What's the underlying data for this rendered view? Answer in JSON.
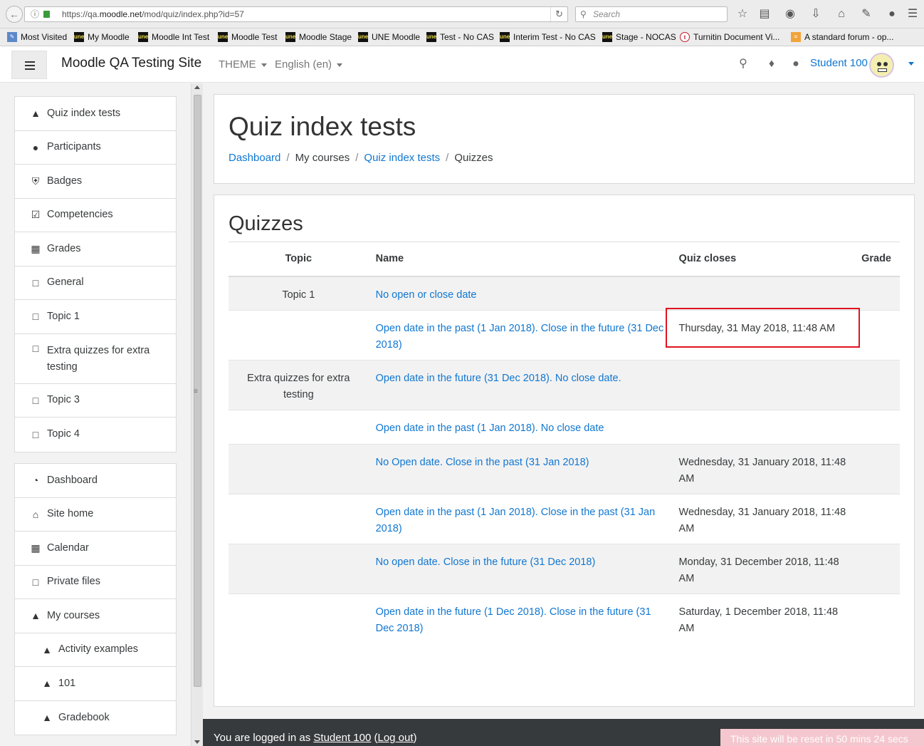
{
  "browser": {
    "url_prefix": "https://qa.",
    "url_host": "moodle.net",
    "url_path": "/mod/quiz/index.php?id=57",
    "search_placeholder": "Search",
    "bookmarks": [
      {
        "label": "Most Visited",
        "icon": "most-visited-icon"
      },
      {
        "label": "My Moodle",
        "icon": "une-icon"
      },
      {
        "label": "Moodle Int Test",
        "icon": "une-icon"
      },
      {
        "label": "Moodle Test",
        "icon": "une-icon"
      },
      {
        "label": "Moodle Stage",
        "icon": "une-icon"
      },
      {
        "label": "UNE Moodle",
        "icon": "une-icon"
      },
      {
        "label": "Test - No CAS",
        "icon": "une-icon"
      },
      {
        "label": "Interim Test - No CAS",
        "icon": "une-icon"
      },
      {
        "label": "Stage - NOCAS",
        "icon": "une-icon"
      },
      {
        "label": "Turnitin Document Vi...",
        "icon": "turnitin-icon"
      },
      {
        "label": "A standard forum - op...",
        "icon": "rss-icon"
      }
    ]
  },
  "navbar": {
    "site_name": "Moodle QA Testing Site",
    "theme_label": "THEME",
    "language_label": "English (en)",
    "user_name": "Student 100"
  },
  "sidebar": {
    "course_items": [
      {
        "label": "Quiz index tests",
        "icon": "graduation-cap-icon"
      },
      {
        "label": "Participants",
        "icon": "users-icon"
      },
      {
        "label": "Badges",
        "icon": "shield-icon"
      },
      {
        "label": "Competencies",
        "icon": "check-square-icon"
      },
      {
        "label": "Grades",
        "icon": "table-icon"
      },
      {
        "label": "General",
        "icon": "folder-icon"
      },
      {
        "label": "Topic 1",
        "icon": "folder-icon"
      },
      {
        "label": "Extra quizzes for extra testing",
        "icon": "folder-icon"
      },
      {
        "label": "Topic 3",
        "icon": "folder-icon"
      },
      {
        "label": "Topic 4",
        "icon": "folder-icon"
      }
    ],
    "site_items": [
      {
        "label": "Dashboard",
        "icon": "dashboard-icon"
      },
      {
        "label": "Site home",
        "icon": "home-icon"
      },
      {
        "label": "Calendar",
        "icon": "calendar-icon"
      },
      {
        "label": "Private files",
        "icon": "file-icon"
      },
      {
        "label": "My courses",
        "icon": "graduation-cap-icon"
      },
      {
        "label": "Activity examples",
        "icon": "graduation-cap-icon"
      },
      {
        "label": "101",
        "icon": "graduation-cap-icon"
      },
      {
        "label": "Gradebook",
        "icon": "graduation-cap-icon"
      }
    ]
  },
  "header": {
    "title": "Quiz index tests",
    "breadcrumb": [
      "Dashboard",
      "My courses",
      "Quiz index tests",
      "Quizzes"
    ]
  },
  "quizzes": {
    "title": "Quizzes",
    "columns": [
      "Topic",
      "Name",
      "Quiz closes",
      "Grade"
    ],
    "rows": [
      {
        "topic": "Topic 1",
        "name": "No open or close date",
        "closes": ""
      },
      {
        "topic": "",
        "name": "Open date in the past (1 Jan 2018). Close in the future (31 Dec 2018)",
        "closes": "Thursday, 31 May 2018, 11:48 AM"
      },
      {
        "topic": "Extra quizzes for extra testing",
        "name": "Open date in the future (31 Dec 2018). No close date.",
        "closes": ""
      },
      {
        "topic": "",
        "name": "Open date in the past (1 Jan 2018). No close date",
        "closes": ""
      },
      {
        "topic": "",
        "name": "No Open date. Close in the past (31 Jan 2018)",
        "closes": "Wednesday, 31 January 2018, 11:48 AM"
      },
      {
        "topic": "",
        "name": "Open date in the past (1 Jan 2018). Close in the past (31 Jan 2018)",
        "closes": "Wednesday, 31 January 2018, 11:48 AM"
      },
      {
        "topic": "",
        "name": "No open date. Close in the future (31 Dec 2018)",
        "closes": "Monday, 31 December 2018, 11:48 AM"
      },
      {
        "topic": "",
        "name": "Open date in the future (1 Dec 2018). Close in the future (31 Dec 2018)",
        "closes": "Saturday, 1 December 2018, 11:48 AM"
      }
    ]
  },
  "footer": {
    "logged_in_prefix": "You are logged in as",
    "user_link": "Student 100",
    "logout_link": "Log out",
    "reset_notice": "This site will be reset in 50 mins 24 secs"
  },
  "colors": {
    "link": "#1177d1",
    "highlight_border": "#e0141e",
    "footer_bg": "#373a3c"
  }
}
